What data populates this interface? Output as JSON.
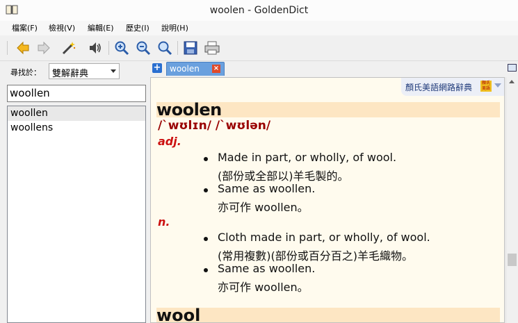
{
  "window": {
    "title": "woolen - GoldenDict"
  },
  "menu": [
    {
      "label": "檔案(F)"
    },
    {
      "label": "檢視(V)"
    },
    {
      "label": "編輯(E)"
    },
    {
      "label": "歷史(I)"
    },
    {
      "label": "說明(H)"
    }
  ],
  "toolbar": {
    "icons": [
      "back-arrow-icon",
      "forward-arrow-icon",
      "magic-wand-icon",
      "speaker-icon",
      "zoom-in-icon",
      "zoom-out-icon",
      "zoom-reset-icon",
      "save-icon",
      "print-icon"
    ]
  },
  "search": {
    "label": "尋找於：",
    "group_selected": "雙解辭典",
    "query": "woollen"
  },
  "wordlist": [
    "woollen",
    "woollens"
  ],
  "tabs": [
    {
      "label": "woolen"
    }
  ],
  "article": {
    "dictionary_name": "顏氏美語網路辭典",
    "dictionary_badge": "顏氏美語",
    "headword": "woolen",
    "phonetic": "/ˋwʊlɪn/ /ˋwʊlən/",
    "senses": [
      {
        "pos": "adj.",
        "defs": [
          {
            "en": "Made in part, or wholly, of wool.",
            "zh": "(部份或全部以)羊毛製的。"
          },
          {
            "en": "Same as woollen.",
            "zh": "亦可作 woollen。"
          }
        ]
      },
      {
        "pos": "n.",
        "defs": [
          {
            "en": "Cloth made in part, or wholly, of wool.",
            "zh": "(常用複數)(部份或百分百之)羊毛織物。"
          },
          {
            "en": "Same as woollen.",
            "zh": "亦可作 woollen。"
          }
        ]
      }
    ],
    "next_headword": "wool"
  },
  "colors": {
    "headword_bg": "#fde6c3",
    "article_bg": "#fffbee",
    "pos_red": "#cc1111",
    "phonetic_red": "#990000",
    "tab_blue": "#6aa0de"
  }
}
